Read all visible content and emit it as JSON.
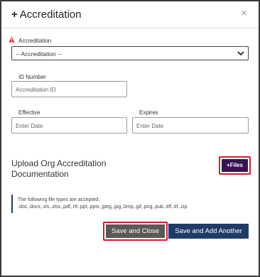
{
  "dialog": {
    "title_icon": "+",
    "title": "Accreditation",
    "close_icon": "×"
  },
  "accreditation": {
    "label": "Accreditation",
    "required_icon": "warning-icon",
    "required_color": "#d9343f",
    "selected": "-- Accreditation --"
  },
  "id_number": {
    "label": "ID Number",
    "placeholder": "Accreditation ID"
  },
  "effective": {
    "label": "Effective",
    "placeholder": "Enter Date"
  },
  "expires": {
    "label": "Expires",
    "placeholder": "Enter Date"
  },
  "upload": {
    "title": "Upload Org Accreditation Documentation",
    "files_button": "+Files",
    "files_button_color": "#3a1253"
  },
  "file_types": {
    "intro": "The following file types are accepted:",
    "list": ".doc,.docx,.xls,.xlsx,.pdf,.rtf,.ppt,.pptx,.jpeg,.jpg,.bmp,.gif,.png,.pub,.tiff,.tif,.zip"
  },
  "actions": {
    "save_close": "Save and Close",
    "save_close_color": "#595959",
    "save_add": "Save and Add Another",
    "save_add_color": "#1f3c66",
    "highlight_color": "#cc1f2d"
  }
}
